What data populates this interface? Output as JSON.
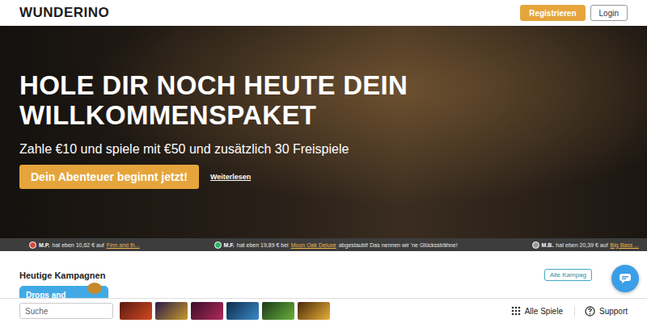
{
  "header": {
    "logo": "WUNDERINO",
    "buttons": [
      {
        "label": "Registrieren",
        "kind": "primary"
      },
      {
        "label": "Login",
        "kind": "outline"
      }
    ]
  },
  "hero": {
    "title_lines": [
      "HOLE DIR NOCH HEUTE DEIN",
      "WILLKOMMENSPAKET"
    ],
    "subtitle": "Zahle €10 und spiele mit €50 und zusätzlich 30 Freispiele",
    "cta": "Dein Abenteuer beginnt jetzt!",
    "link": "Weiterlesen"
  },
  "ticker": [
    {
      "user": "M.P.",
      "before": "hat eben 10,62 € auf",
      "game": "Finn and th...",
      "after": "",
      "color": "#d9463b"
    },
    {
      "user": "M.F.",
      "before": "hat eben 19,89 € bei",
      "game": "Moon Oak Deluxe",
      "after": "abgestaubt! Das nennen wir 'ne Glückssträhne!",
      "color": "#2fb36b"
    },
    {
      "user": "M.B.",
      "before": "hat eben 20,39 € auf",
      "game": "Big Bass ...",
      "after": "",
      "color": "#9a9a9a"
    }
  ],
  "campaigns": {
    "title": "Heutige Kampagnen",
    "all_button": "Alle Kampag",
    "cards": [
      {
        "label": "Drops and"
      }
    ]
  },
  "bottom_bar": {
    "search_placeholder": "Suche",
    "links": [
      {
        "label": "Alle Spiele",
        "kind": "grid"
      },
      {
        "label": "Support",
        "kind": "help"
      }
    ]
  }
}
